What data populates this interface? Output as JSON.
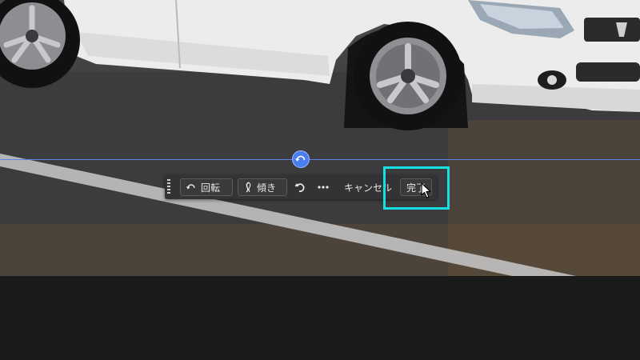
{
  "toolbar": {
    "rotate_label": "回転",
    "skew_label": "傾き",
    "cancel_label": "キャンセル",
    "done_label": "完了"
  },
  "icons": {
    "rotate": "rotate-icon",
    "skew": "skew-icon",
    "undo": "undo-icon",
    "more": "more-icon",
    "handle": "rotate-handle-icon",
    "cursor": "cursor-arrow-icon"
  },
  "colors": {
    "guide_line": "#5f86e6",
    "handle": "#4a7ff0",
    "highlight": "#17e0e5",
    "toolbar": "#333335"
  }
}
